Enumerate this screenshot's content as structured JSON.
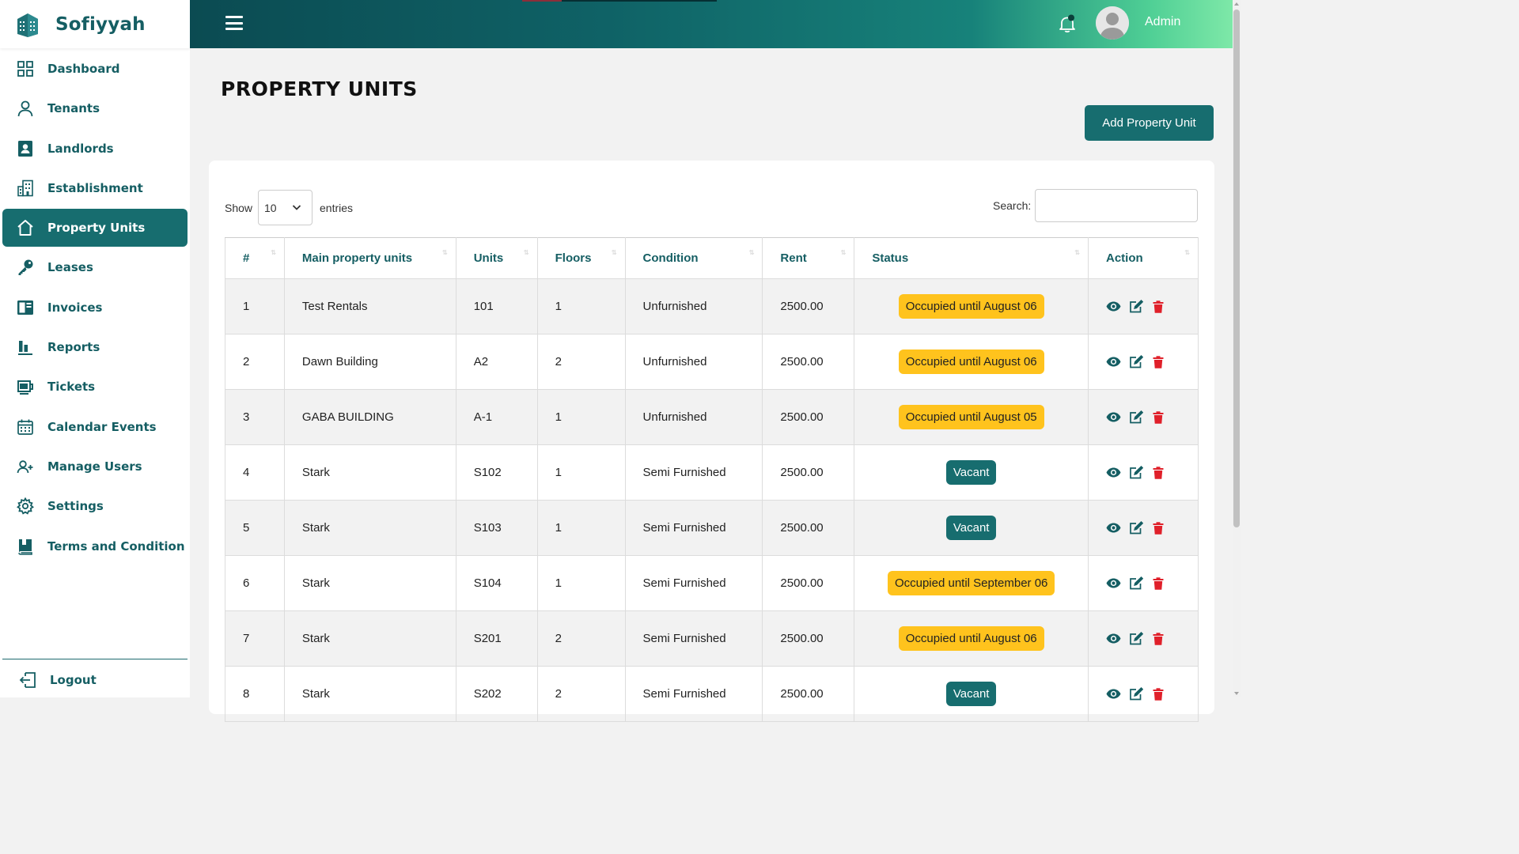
{
  "brand": {
    "name": "Sofiyyah"
  },
  "sidebar": {
    "items": [
      {
        "label": "Dashboard",
        "icon": "dashboard-grid-icon"
      },
      {
        "label": "Tenants",
        "icon": "user-icon"
      },
      {
        "label": "Landlords",
        "icon": "contact-card-icon"
      },
      {
        "label": "Establishment",
        "icon": "building-icon"
      },
      {
        "label": "Property Units",
        "icon": "home-icon",
        "active": true
      },
      {
        "label": "Leases",
        "icon": "key-icon"
      },
      {
        "label": "Invoices",
        "icon": "invoice-book-icon"
      },
      {
        "label": "Reports",
        "icon": "bar-chart-icon"
      },
      {
        "label": "Tickets",
        "icon": "ticket-icon"
      },
      {
        "label": "Calendar Events",
        "icon": "calendar-icon"
      },
      {
        "label": "Manage Users",
        "icon": "add-user-icon"
      },
      {
        "label": "Settings",
        "icon": "gear-icon"
      },
      {
        "label": "Terms and Condition",
        "icon": "book-icon"
      }
    ],
    "logout_label": "Logout"
  },
  "header": {
    "user_name": "Admin"
  },
  "page": {
    "title": "PROPERTY UNITS",
    "add_button": "Add Property Unit"
  },
  "table_controls": {
    "show_label": "Show",
    "entries_value": "10",
    "entries_label": "entries",
    "search_label": "Search:",
    "search_value": ""
  },
  "table": {
    "columns": [
      "#",
      "Main property units",
      "Units",
      "Floors",
      "Condition",
      "Rent",
      "Status",
      "Action"
    ],
    "rows": [
      {
        "num": "1",
        "main": "Test Rentals",
        "unit": "101",
        "floors": "1",
        "condition": "Unfurnished",
        "rent": "2500.00",
        "status": "Occupied until August 06",
        "status_type": "occupied"
      },
      {
        "num": "2",
        "main": "Dawn Building",
        "unit": "A2",
        "floors": "2",
        "condition": "Unfurnished",
        "rent": "2500.00",
        "status": "Occupied until August 06",
        "status_type": "occupied"
      },
      {
        "num": "3",
        "main": "GABA BUILDING",
        "unit": "A-1",
        "floors": "1",
        "condition": "Unfurnished",
        "rent": "2500.00",
        "status": "Occupied until August 05",
        "status_type": "occupied"
      },
      {
        "num": "4",
        "main": "Stark",
        "unit": "S102",
        "floors": "1",
        "condition": "Semi Furnished",
        "rent": "2500.00",
        "status": "Vacant",
        "status_type": "vacant"
      },
      {
        "num": "5",
        "main": "Stark",
        "unit": "S103",
        "floors": "1",
        "condition": "Semi Furnished",
        "rent": "2500.00",
        "status": "Vacant",
        "status_type": "vacant"
      },
      {
        "num": "6",
        "main": "Stark",
        "unit": "S104",
        "floors": "1",
        "condition": "Semi Furnished",
        "rent": "2500.00",
        "status": "Occupied until September 06",
        "status_type": "occupied"
      },
      {
        "num": "7",
        "main": "Stark",
        "unit": "S201",
        "floors": "2",
        "condition": "Semi Furnished",
        "rent": "2500.00",
        "status": "Occupied until August 06",
        "status_type": "occupied"
      },
      {
        "num": "8",
        "main": "Stark",
        "unit": "S202",
        "floors": "2",
        "condition": "Semi Furnished",
        "rent": "2500.00",
        "status": "Vacant",
        "status_type": "vacant"
      }
    ]
  },
  "colors": {
    "primary": "#176d6f",
    "occupied": "#ffc31d",
    "delete": "#e0202a"
  }
}
